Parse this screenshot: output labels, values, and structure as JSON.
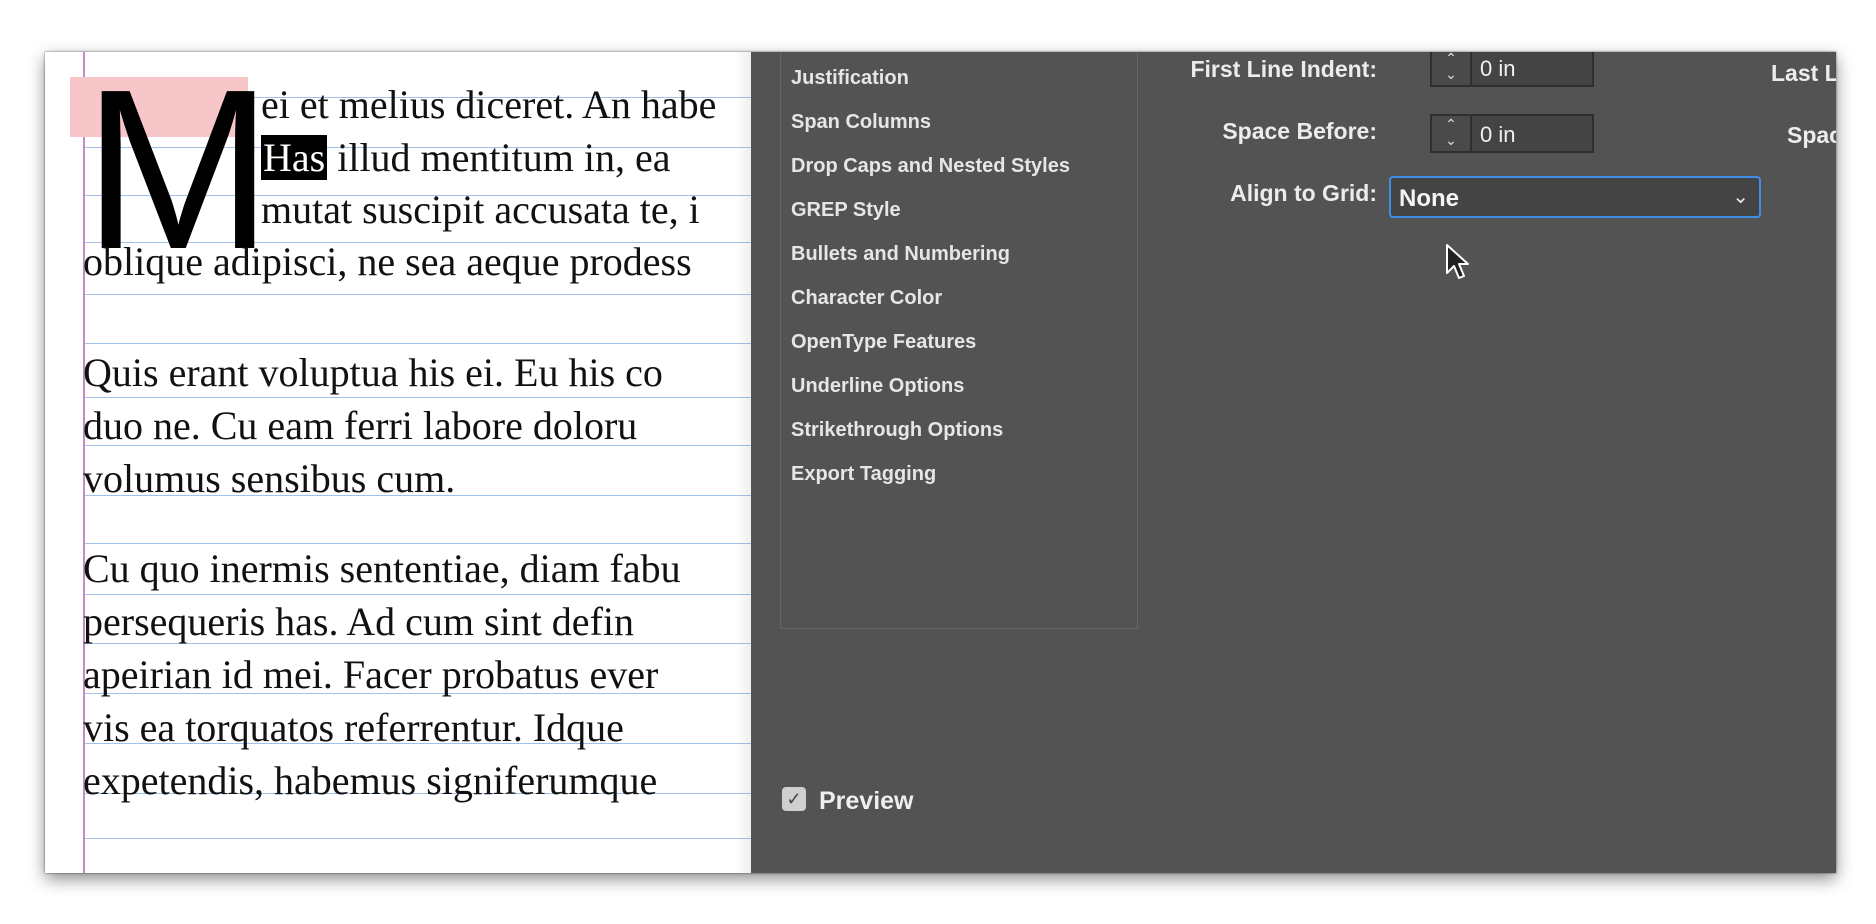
{
  "document": {
    "drop_cap": "M",
    "lines": [
      "ei et melius diceret. An habe",
      "illud mentitum in, ea",
      "mutat suscipit accusata te, i",
      "oblique adipisci, ne sea aeque prodess",
      "Quis erant voluptua his ei. Eu his co",
      "duo ne. Cu eam ferri labore doloru",
      "volumus sensibus cum.",
      "Cu quo inermis sententiae, diam fabu",
      "persequeris has. Ad cum sint defin",
      "apeirian id mei. Facer probatus ever",
      "vis ea torquatos referrentur. Idque",
      "expetendis, habemus signiferumque"
    ],
    "selected_word": "Has"
  },
  "dialog": {
    "categories": [
      "Justification",
      "Span Columns",
      "Drop Caps and Nested Styles",
      "GREP Style",
      "Bullets and Numbering",
      "Character Color",
      "OpenType Features",
      "Underline Options",
      "Strikethrough Options",
      "Export Tagging"
    ],
    "fields": {
      "first_line_indent_label": "First Line Indent:",
      "first_line_indent_value": "0 in",
      "space_before_label": "Space Before:",
      "space_before_value": "0 in",
      "align_to_grid_label": "Align to Grid:",
      "align_to_grid_value": "None",
      "last_line_label": "Last Line",
      "space_after_label": "Spac"
    },
    "preview_label": "Preview",
    "preview_checked": true,
    "colors": {
      "dialog_bg": "#535353",
      "focus_ring": "#3e8ee8",
      "drop_cap_highlight": "#f7c6c8"
    }
  }
}
